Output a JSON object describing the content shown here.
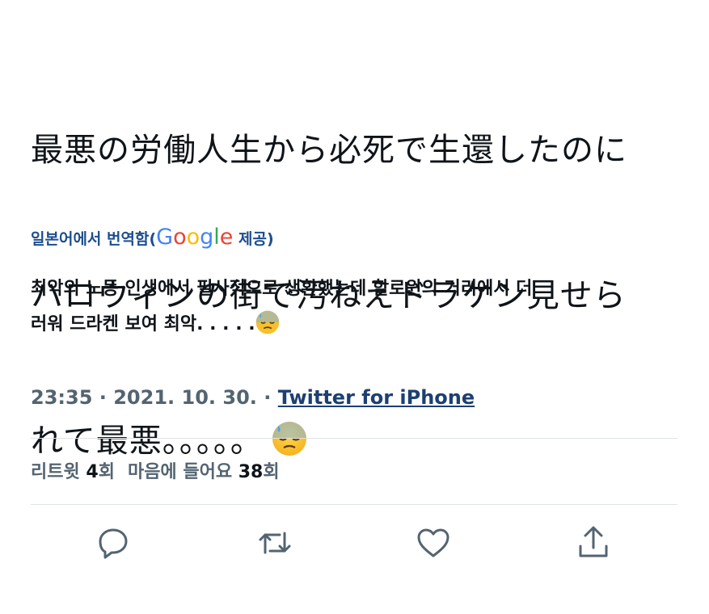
{
  "tweet": {
    "lines": [
      "最悪の労働人生から必死で生還したのに",
      "ハロウィンの街で汚ねえドラケン見せら",
      "れて最悪。。。。。"
    ],
    "emoji": "downcast-face-with-sweat"
  },
  "translation": {
    "label_prefix": "일본어에서 번역함(",
    "google": [
      "G",
      "o",
      "o",
      "g",
      "l",
      "e"
    ],
    "label_suffix": " 제공)",
    "lines": [
      "최악의 노동 인생에서 필사적으로 생환했는데 할로윈의 거리에서 더",
      "러워 드라켄 보여 최악. . . . ."
    ]
  },
  "meta": {
    "timestamp": "23:35 · 2021. 10. 30. · ",
    "source": "Twitter for iPhone"
  },
  "stats": {
    "retweets_label": "리트윗 ",
    "retweets_count": "4",
    "retweets_unit": "회",
    "likes_label": "마음에 들어요 ",
    "likes_count": "38",
    "likes_unit": "회"
  },
  "actions": {
    "icons": [
      "reply-icon",
      "retweet-icon",
      "like-icon",
      "share-icon"
    ],
    "color": "#536471"
  }
}
